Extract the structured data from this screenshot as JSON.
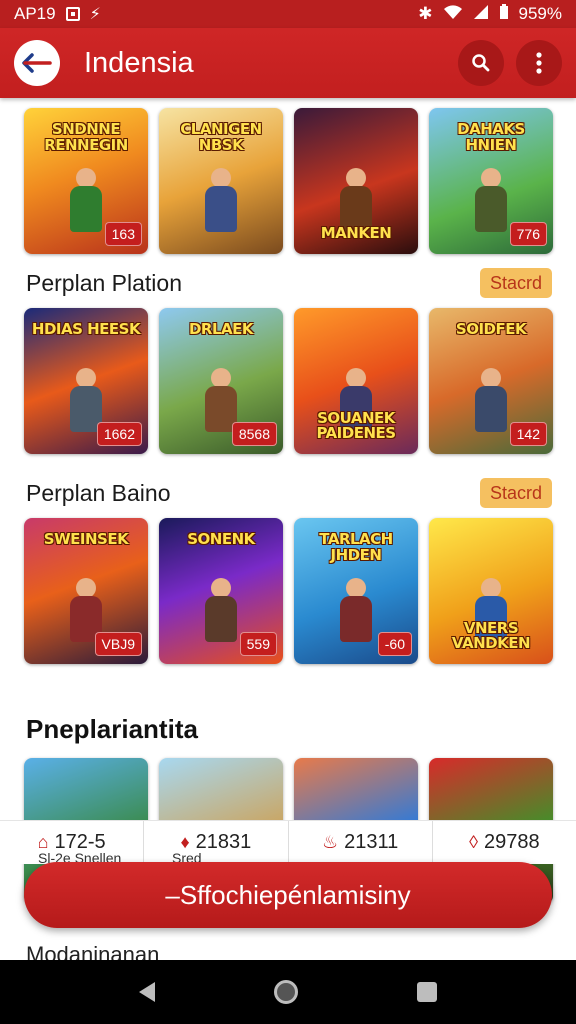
{
  "status_bar": {
    "time": "AP19",
    "battery": "959%"
  },
  "app_bar": {
    "title": "Indensia"
  },
  "rows": [
    {
      "tiles": [
        {
          "title": "SNDNNE RENNEGIN",
          "badge": "163",
          "bg": "linear-gradient(160deg,#ffd23a,#f08a1f 45%,#b8321b)",
          "hero": "#2f7d2f"
        },
        {
          "title": "CLANIGEN NBSK",
          "badge": "",
          "bg": "linear-gradient(160deg,#f6e3a2,#e8a33a 50%,#7a4a1e)",
          "hero": "#3a4f88"
        },
        {
          "title": "MANKEN",
          "badge": "",
          "bg": "linear-gradient(160deg,#3a1a3a,#c8361e 55%,#2a0d0d)",
          "hero": "#6a3a1a"
        },
        {
          "title": "DAHAKS HNIEN",
          "badge": "776",
          "bg": "linear-gradient(160deg,#7ec6f0,#5ab34a 60%,#2d6a3a)",
          "hero": "#4a5a2a"
        }
      ]
    },
    {
      "tiles": [
        {
          "title": "HDIAS HEESK",
          "badge": "1662",
          "bg": "linear-gradient(160deg,#1a2a7a,#e85a1a 50%,#3a1a4a)",
          "hero": "#4a5a6a"
        },
        {
          "title": "DRLAEK",
          "badge": "8568",
          "bg": "linear-gradient(160deg,#8ec9f0,#7aa84a 55%,#3a5a2a)",
          "hero": "#7a4a2a"
        },
        {
          "title": "SOUANEK PAIDENES",
          "badge": "",
          "bg": "linear-gradient(160deg,#ff9a2a,#e8501a 50%,#6a2a5a)",
          "hero": "#3a3a6a"
        },
        {
          "title": "SOIDFEK",
          "badge": "142",
          "bg": "linear-gradient(160deg,#e8b86a,#d86a2a 50%,#4a6a3a)",
          "hero": "#3a4a6a"
        }
      ]
    },
    {
      "tiles": [
        {
          "title": "SWEINSEK",
          "badge": "VBJ9",
          "bg": "linear-gradient(160deg,#c83a6a,#e8601a 45%,#2a1a3a)",
          "hero": "#8a2a2a"
        },
        {
          "title": "SONENK",
          "badge": "559",
          "bg": "linear-gradient(160deg,#1a1a5a,#7a2ac8 45%,#e8501a)",
          "hero": "#5a3a2a"
        },
        {
          "title": "TARLACH JHDEN",
          "badge": "-60",
          "bg": "linear-gradient(160deg,#6ac6f0,#2a8ad0 55%,#1a4a8a)",
          "hero": "#7a2a2a"
        },
        {
          "title": "VNERS VANDKEN",
          "badge": "",
          "bg": "linear-gradient(160deg,#ffe84a,#f0a01a 55%,#d8501a)",
          "hero": "#2a5aa8"
        }
      ]
    },
    {
      "tiles": [
        {
          "title": "",
          "badge": "",
          "bg": "linear-gradient(160deg,#5ab0e8,#3a8a4a 60%,#2a4a2a)",
          "hero": "#2a7a4a"
        },
        {
          "title": "",
          "badge": "",
          "bg": "linear-gradient(160deg,#a8d8f0,#c8a86a 55%,#5a4a3a)",
          "hero": "#3a4a5a"
        },
        {
          "title": "",
          "badge": "",
          "bg": "linear-gradient(160deg,#e87a4a,#3a7ad0 55%,#2a3a6a)",
          "hero": "#c84a1a"
        },
        {
          "title": "",
          "badge": "",
          "bg": "linear-gradient(160deg,#d82a2a,#4a8a2a 55%,#2a3a1a)",
          "hero": "#2a2a2a"
        }
      ]
    }
  ],
  "sections": [
    {
      "label": "Perplan Plation",
      "chip": "Stacrd"
    },
    {
      "label": "Perplan Baino",
      "chip": "Stacrd"
    },
    {
      "heading": "Pneplariantita"
    }
  ],
  "stats": [
    {
      "icon": "ticket-icon",
      "glyph": "⌂",
      "value": "172-5"
    },
    {
      "icon": "gem-icon",
      "glyph": "♦",
      "value": "21831"
    },
    {
      "icon": "flame-icon",
      "glyph": "♨",
      "value": "21311"
    },
    {
      "icon": "shield-icon",
      "glyph": "◊",
      "value": "29788"
    }
  ],
  "stat_subs": [
    "Sl-2e Snellen",
    "Sred"
  ],
  "cta": {
    "label": "–Sffochiepénlamisiny"
  },
  "footer_peek": "Modaninanan",
  "colors": {
    "primary": "#c21f1f",
    "chip_bg": "#f5c060",
    "chip_text": "#b8361a"
  }
}
